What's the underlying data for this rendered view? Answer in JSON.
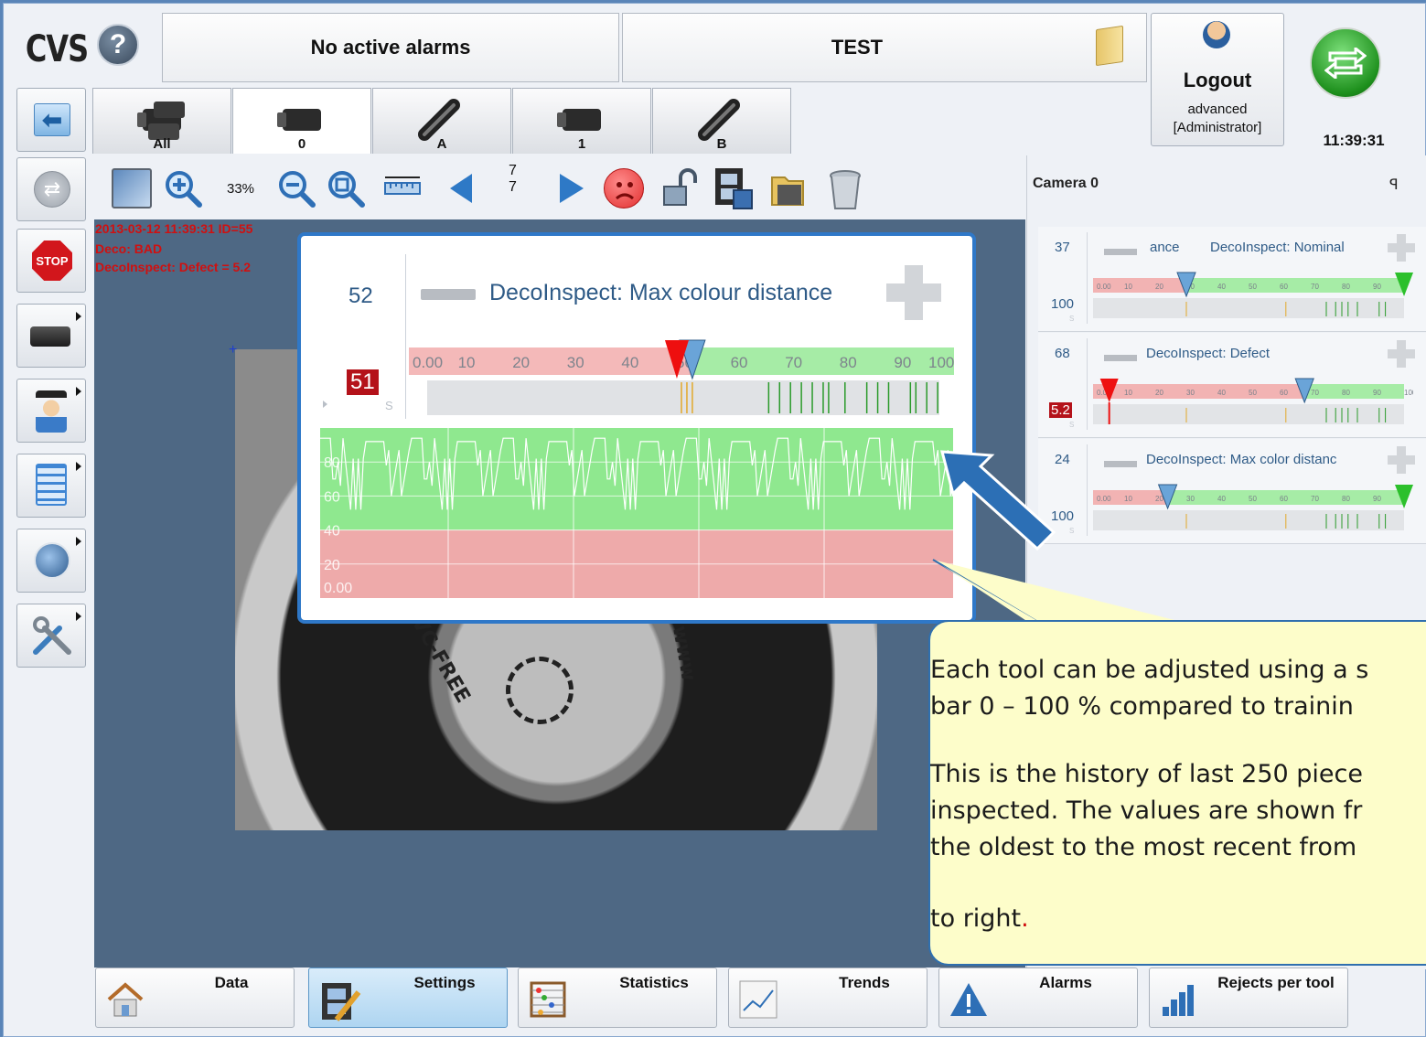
{
  "header": {
    "logo": "CVS",
    "alarm_text": "No active alarms",
    "job_name": "TEST",
    "logout_label": "Logout",
    "user_level": "advanced",
    "user_role": "[Administrator]",
    "clock": "11:39:31"
  },
  "camera_tabs": [
    {
      "label": "All",
      "active": false
    },
    {
      "label": "0",
      "active": true
    },
    {
      "label": "A",
      "active": false
    },
    {
      "label": "1",
      "active": false
    },
    {
      "label": "B",
      "active": false
    }
  ],
  "toolbar": {
    "zoom": "33%",
    "counter_top": "7",
    "counter_bottom": "7"
  },
  "overlay": {
    "line1": "2013-03-12 11:39:31 ID=55",
    "line2": "Deco: BAD",
    "line3": "DecoInspect: Defect = 5.2"
  },
  "right_panel": {
    "title": "Camera 0",
    "pin": "ᵖ",
    "tools": [
      {
        "top_value": "37",
        "name_prefix": "ance",
        "name": "DecoInspect: Nominal",
        "bottom_value": "100",
        "bottom_bad": false,
        "ticks": [
          "0.00",
          "10",
          "20",
          "30",
          "40",
          "50",
          "60",
          "70",
          "80",
          "90"
        ],
        "threshold": 30,
        "marker": 100
      },
      {
        "top_value": "68",
        "name_prefix": "",
        "name": "DecoInspect: Defect",
        "bottom_value": "5.2",
        "bottom_bad": true,
        "ticks": [
          "0.00",
          "10",
          "20",
          "30",
          "40",
          "50",
          "60",
          "70",
          "80",
          "90",
          "100"
        ],
        "threshold": 68,
        "marker": 5.2
      },
      {
        "top_value": "24",
        "name_prefix": "",
        "name": "DecoInspect: Max color distanc",
        "bottom_value": "100",
        "bottom_bad": false,
        "ticks": [
          "0.00",
          "10",
          "20",
          "30",
          "40",
          "50",
          "60",
          "70",
          "80",
          "90"
        ],
        "threshold": 24,
        "marker": 100
      }
    ]
  },
  "popup": {
    "top_value": "52",
    "tool_name": "DecoInspect: Max colour distance",
    "bottom_value": "51",
    "s_label": "S",
    "scale_ticks": [
      "0.00",
      "10",
      "20",
      "30",
      "40",
      "50",
      "60",
      "70",
      "80",
      "90",
      "100"
    ],
    "threshold": 52,
    "marker": 51,
    "history_axis": [
      "80",
      "60",
      "40",
      "20",
      "0.00"
    ],
    "history_good_min": 40
  },
  "callout": {
    "line1": "Each tool can be adjusted using a s",
    "line2": "bar 0 – 100 % compared to trainin",
    "line3": "This is the history of last 250 piece",
    "line4": "inspected. The values are shown fr",
    "line5": "the oldest to the most recent from",
    "line6a": "to right",
    "line6b": "."
  },
  "bottom_nav": [
    {
      "label": "Data",
      "icon": "home-icon"
    },
    {
      "label": "Settings",
      "icon": "settings-film-icon",
      "selected": true
    },
    {
      "label": "Statistics",
      "icon": "abacus-icon"
    },
    {
      "label": "Trends",
      "icon": "trend-chart-icon"
    },
    {
      "label": "Alarms",
      "icon": "warning-icon"
    },
    {
      "label": "Rejects per tool",
      "icon": "bar-chart-icon"
    }
  ],
  "colors": {
    "good": "#8fe88f",
    "bad": "#f2a9a9",
    "accent": "#2f78c8",
    "alarm_text": "#d01010"
  }
}
